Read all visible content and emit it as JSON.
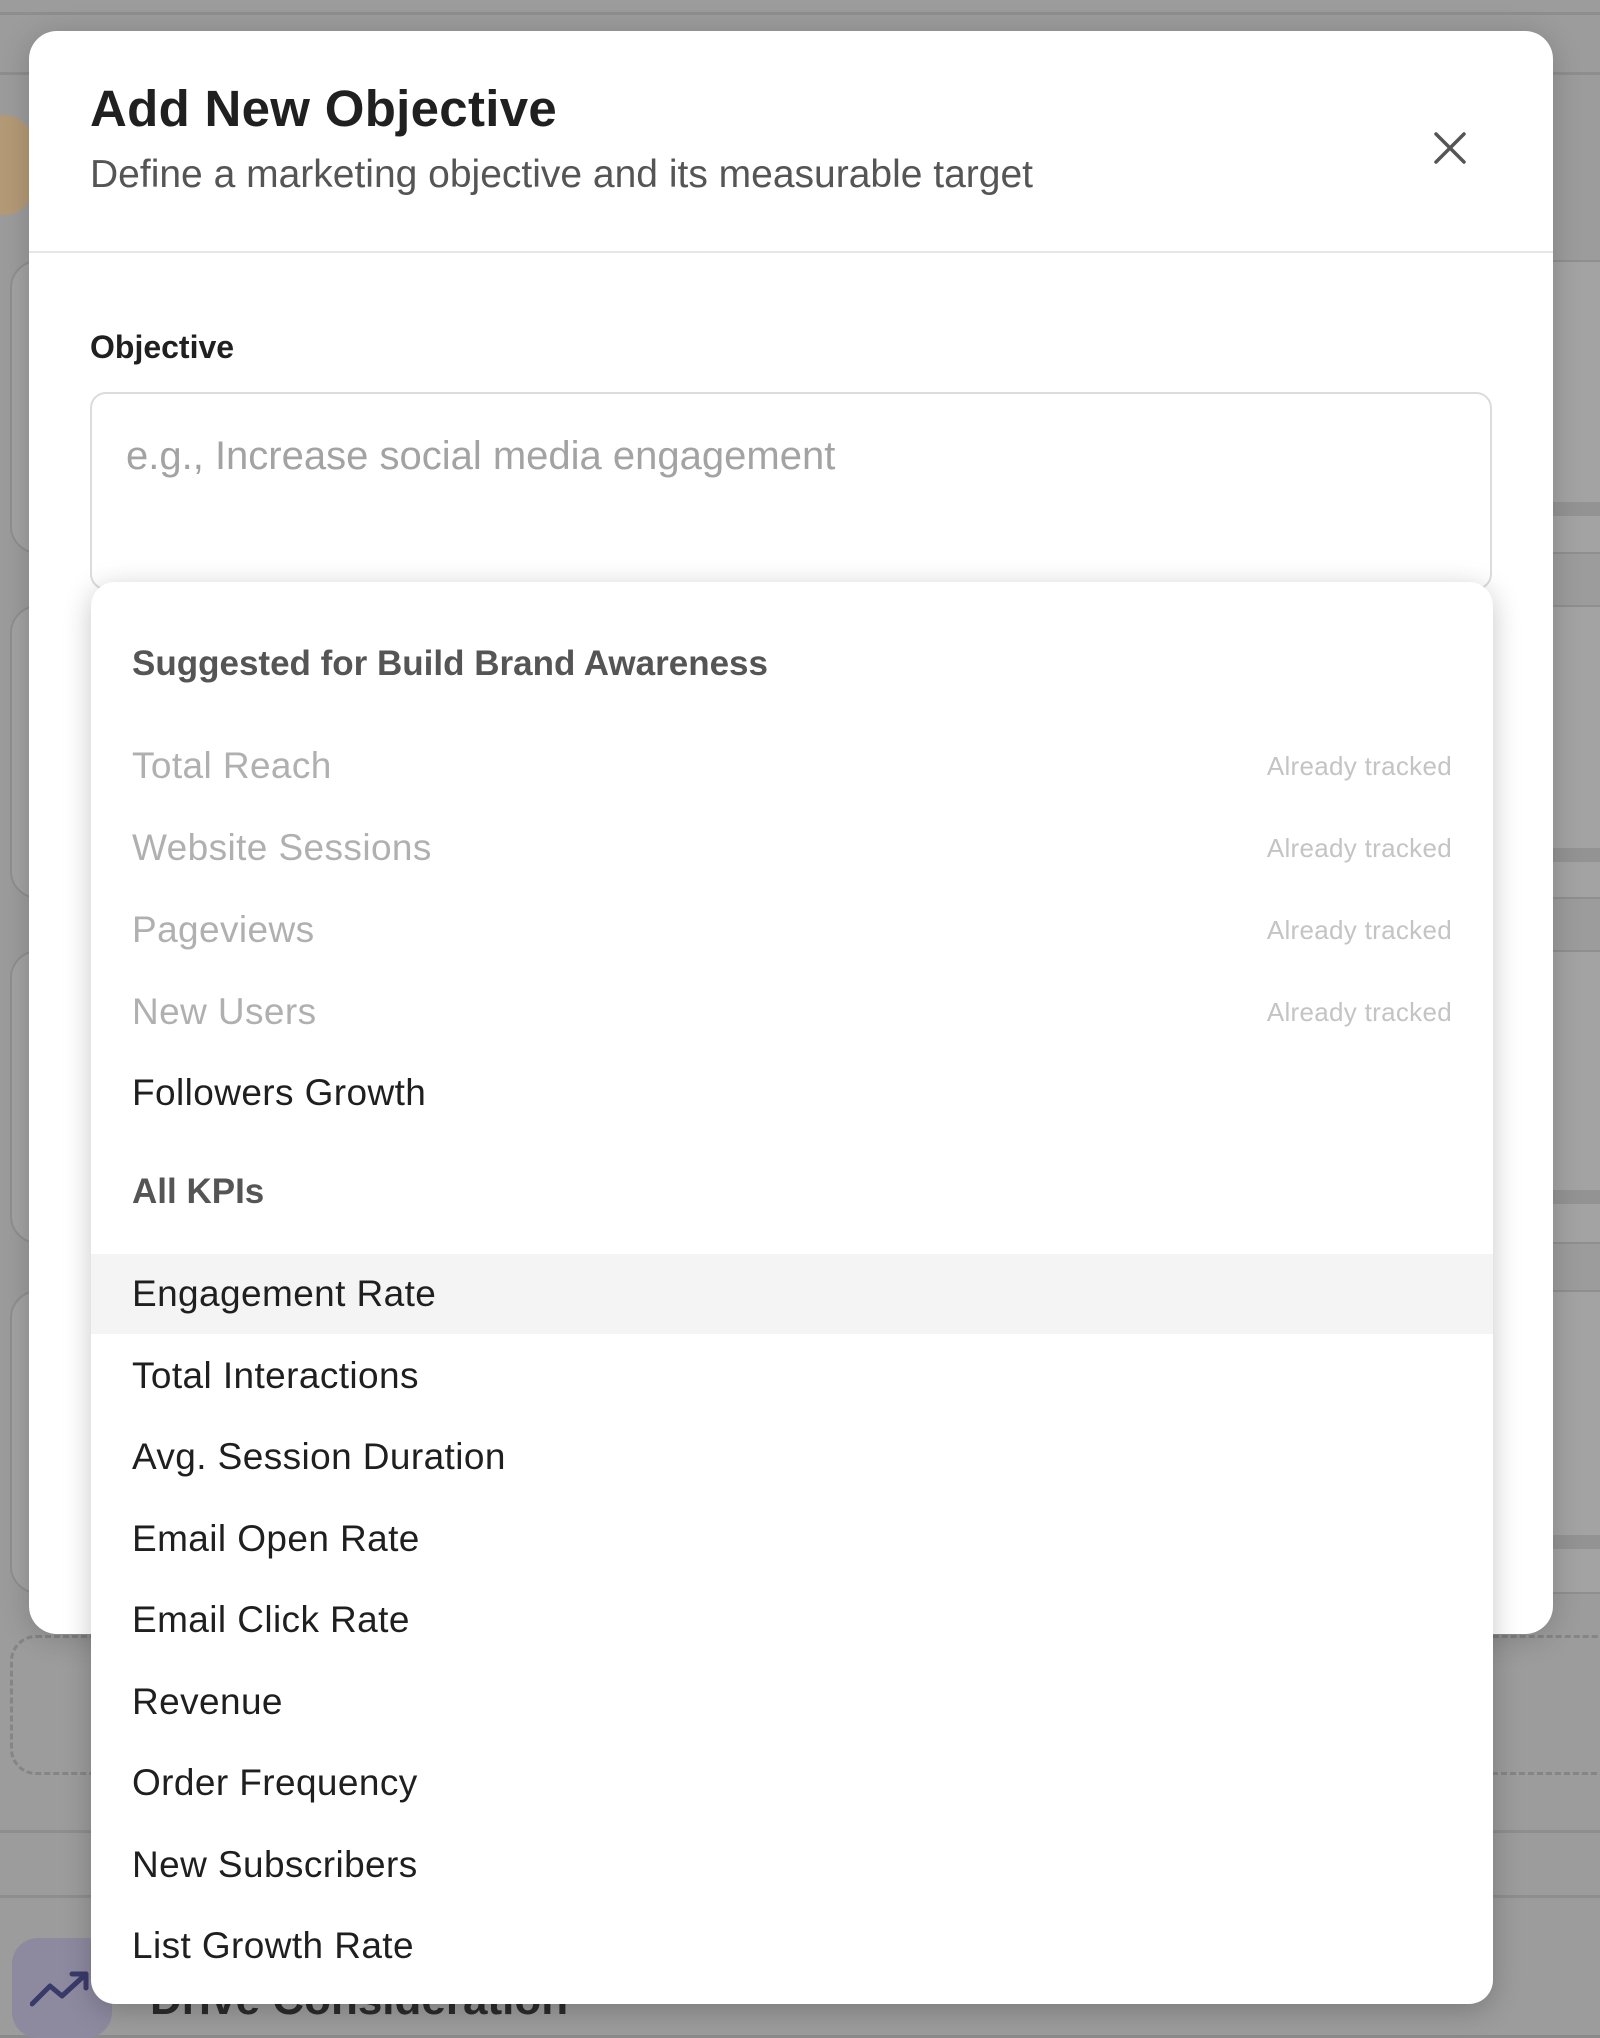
{
  "background": {
    "section_heading": "Drive Consideration",
    "icon": "trending-up-icon"
  },
  "modal": {
    "title": "Add New Objective",
    "subtitle": "Define a marketing objective and its measurable target",
    "close_icon": "close-icon",
    "objective_label": "Objective",
    "objective_placeholder": "e.g., Increase social media engagement",
    "objective_value": ""
  },
  "dropdown": {
    "suggested_heading": "Suggested for Build Brand Awareness",
    "suggested": [
      {
        "label": "Total Reach",
        "note": "Already tracked",
        "disabled": true
      },
      {
        "label": "Website Sessions",
        "note": "Already tracked",
        "disabled": true
      },
      {
        "label": "Pageviews",
        "note": "Already tracked",
        "disabled": true
      },
      {
        "label": "New Users",
        "note": "Already tracked",
        "disabled": true
      },
      {
        "label": "Followers Growth",
        "note": "",
        "disabled": false
      }
    ],
    "all_heading": "All KPIs",
    "all": [
      {
        "label": "Engagement Rate",
        "highlighted": true
      },
      {
        "label": "Total Interactions"
      },
      {
        "label": "Avg. Session Duration"
      },
      {
        "label": "Email Open Rate"
      },
      {
        "label": "Email Click Rate"
      },
      {
        "label": "Revenue"
      },
      {
        "label": "Order Frequency"
      },
      {
        "label": "New Subscribers"
      },
      {
        "label": "List Growth Rate"
      }
    ]
  },
  "colors": {
    "overlay": "#8a8a8a",
    "modal_bg": "#ffffff",
    "text_primary": "#1f1f1f",
    "text_muted": "#555555",
    "text_disabled": "#b0b0b0",
    "highlight_row": "#f4f4f4",
    "accent": "#5b52c9"
  }
}
